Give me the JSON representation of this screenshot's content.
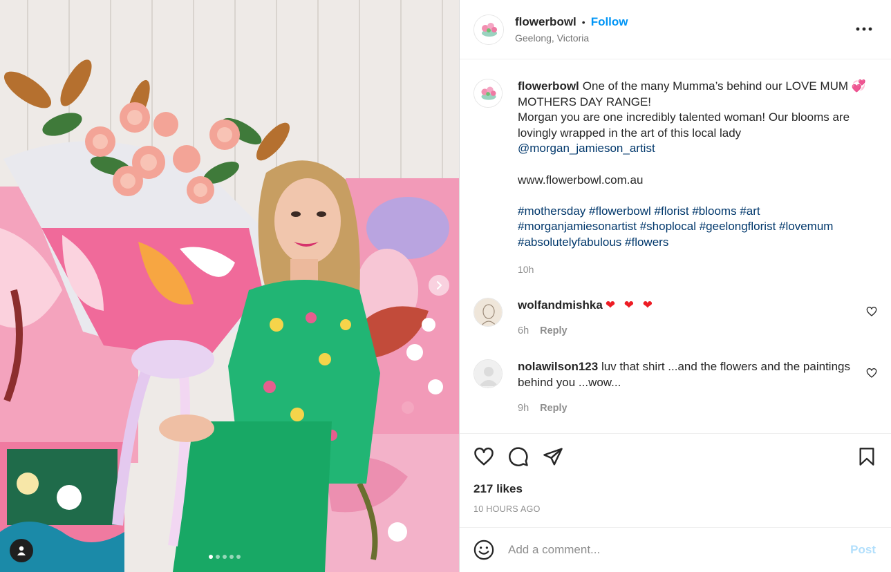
{
  "post": {
    "author": "flowerbowl",
    "follow_label": "Follow",
    "separator": "•",
    "location": "Geelong, Victoria",
    "more_icon": "more-horizontal-icon"
  },
  "media": {
    "image_count": 5,
    "active_index": 1
  },
  "caption": {
    "username": "flowerbowl",
    "line1": "One of the many Mumma’s behind our LOVE MUM 💞 MOTHERS DAY RANGE!",
    "line2": "Morgan you are one incredibly talented woman! Our blooms are lovingly wrapped in the art of this local lady",
    "mention": "@morgan_jamieson_artist",
    "website": "www.flowerbowl.com.au",
    "hashtags": [
      "#mothersday",
      "#flowerbowl",
      "#florist",
      "#blooms",
      "#art",
      "#morganjamiesonartist",
      "#shoplocal",
      "#geelongflorist",
      "#lovemum",
      "#absolutelyfabulous",
      "#flowers"
    ],
    "time": "10h"
  },
  "comments": [
    {
      "username": "wolfandmishka",
      "text": "❤ ❤ ❤",
      "time": "6h",
      "reply_label": "Reply"
    },
    {
      "username": "nolawilson123",
      "text": "luv that shirt ...and the flowers and the paintings behind you ...wow...",
      "time": "9h",
      "reply_label": "Reply"
    }
  ],
  "actions": {
    "likes": "217 likes",
    "posted": "10 HOURS AGO"
  },
  "composer": {
    "placeholder": "Add a comment...",
    "post_label": "Post"
  },
  "colors": {
    "accent": "#0095f6",
    "link": "#00376b",
    "muted": "#8e8e8e",
    "heart_red": "#ed1c24",
    "post_disabled": "#b2dffc"
  }
}
